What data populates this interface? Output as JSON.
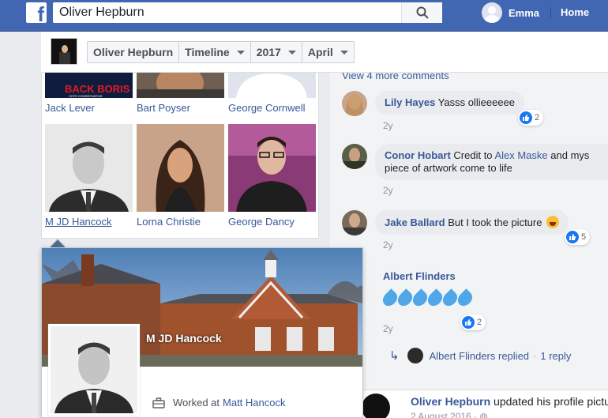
{
  "topbar": {
    "logo": "f",
    "search_value": "Oliver Hepburn",
    "user_name": "Emma",
    "home_label": "Home"
  },
  "subbar": {
    "selectors": [
      "Oliver Hepburn",
      "Timeline",
      "2017",
      "April"
    ]
  },
  "friends": [
    {
      "name": "Jack Lever"
    },
    {
      "name": "Bart Poyser"
    },
    {
      "name": "George Cornwell"
    },
    {
      "name": "M JD Hancock"
    },
    {
      "name": "Lorna Christie"
    },
    {
      "name": "George Dancy"
    }
  ],
  "tile_overlay": {
    "back_boris": "BACK BORIS",
    "vote": "VOTE CONSERVATIVE"
  },
  "hovercard": {
    "name": "M JD Hancock",
    "work_prefix": "Worked at",
    "work_link": "Matt Hancock"
  },
  "comments": {
    "view_more": "View 4 more comments",
    "items": [
      {
        "author": "Lily Hayes",
        "text": "Yasss ollieeeeee",
        "time": "2y",
        "likes": "2"
      },
      {
        "author": "Conor Hobart",
        "text_before": "Credit to",
        "mention": "Alex Maske",
        "text_after": "and mys",
        "line2": "piece of artwork come to life",
        "time": "2y"
      },
      {
        "author": "Jake Ballard",
        "text": "But I took the picture",
        "time": "2y",
        "likes": "5"
      },
      {
        "author": "Albert Flinders",
        "time": "2y",
        "likes": "2"
      }
    ],
    "replied": {
      "text": "Albert Flinders replied",
      "sep": "·",
      "reply_count": "1 reply"
    },
    "post": {
      "author": "Oliver Hepburn",
      "action": "updated his profile pictur",
      "date": "2 August 2016"
    }
  },
  "colors": {
    "brand": "#4267b2",
    "link": "#365899",
    "like_blue": "#1877f2"
  }
}
